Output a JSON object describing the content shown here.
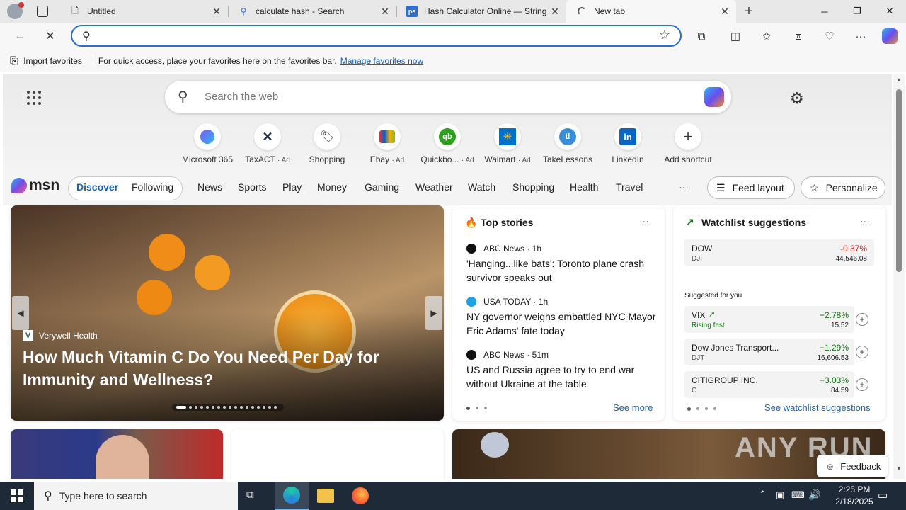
{
  "tabs": [
    {
      "label": "Untitled",
      "icon": "page-icon"
    },
    {
      "label": "calculate hash - Search",
      "icon": "search-icon"
    },
    {
      "label": "Hash Calculator Online — String",
      "icon": "pe-icon"
    },
    {
      "label": "New tab",
      "icon": "loading-icon"
    }
  ],
  "favorites_bar": {
    "import_label": "Import favorites",
    "message": "For quick access, place your favorites here on the favorites bar.",
    "manage_link": "Manage favorites now"
  },
  "search": {
    "placeholder": "Search the web"
  },
  "shortcuts": [
    {
      "label": "Microsoft 365",
      "ad": ""
    },
    {
      "label": "TaxACT",
      "ad": "· Ad"
    },
    {
      "label": "Shopping",
      "ad": ""
    },
    {
      "label": "Ebay",
      "ad": "· Ad"
    },
    {
      "label": "Quickbo...",
      "ad": "· Ad"
    },
    {
      "label": "Walmart",
      "ad": "· Ad"
    },
    {
      "label": "TakeLessons",
      "ad": ""
    },
    {
      "label": "LinkedIn",
      "ad": ""
    },
    {
      "label": "Add shortcut",
      "ad": ""
    }
  ],
  "msn": {
    "logo_text": "msn",
    "feed_tabs": [
      "Discover",
      "Following"
    ],
    "categories": [
      "News",
      "Sports",
      "Play",
      "Money",
      "Gaming",
      "Weather",
      "Watch",
      "Shopping",
      "Health",
      "Travel"
    ],
    "more": "···",
    "feed_layout": "Feed layout",
    "personalize": "Personalize"
  },
  "hero": {
    "source": "Verywell Health",
    "title": "How Much Vitamin C Do You Need Per Day for Immunity and Wellness?"
  },
  "top_stories": {
    "heading": "Top stories",
    "more": "···",
    "items": [
      {
        "source": "ABC News · 1h",
        "title": "'Hanging...like bats': Toronto plane crash survivor speaks out"
      },
      {
        "source": "USA TODAY · 1h",
        "title": "NY governor weighs embattled NYC Mayor Eric Adams' fate today"
      },
      {
        "source": "ABC News · 51m",
        "title": "US and Russia agree to try to end war without Ukraine at the table"
      }
    ],
    "see_more": "See more"
  },
  "watchlist": {
    "heading": "Watchlist suggestions",
    "more": "···",
    "top": {
      "name": "DOW",
      "symbol": "DJI",
      "change": "-0.37%",
      "price": "44,546.08"
    },
    "suggested_label": "Suggested for you",
    "items": [
      {
        "name": "VIX",
        "symbol": "Rising fast",
        "change": "+2.78%",
        "price": "15.52"
      },
      {
        "name": "Dow Jones Transport...",
        "symbol": "DJT",
        "change": "+1.29%",
        "price": "16,606.53"
      },
      {
        "name": "CITIGROUP INC.",
        "symbol": "C",
        "change": "+3.03%",
        "price": "84.59"
      }
    ],
    "see_link": "See watchlist suggestions"
  },
  "feedback": "Feedback",
  "watermark": "ANY RUN",
  "taskbar": {
    "search_placeholder": "Type here to search",
    "time": "2:25 PM",
    "date": "2/18/2025"
  },
  "colors": {
    "accent": "#2a6fd6",
    "positive": "#0f7b0f",
    "negative": "#c42b1c",
    "taskbar": "#1f2a38"
  }
}
